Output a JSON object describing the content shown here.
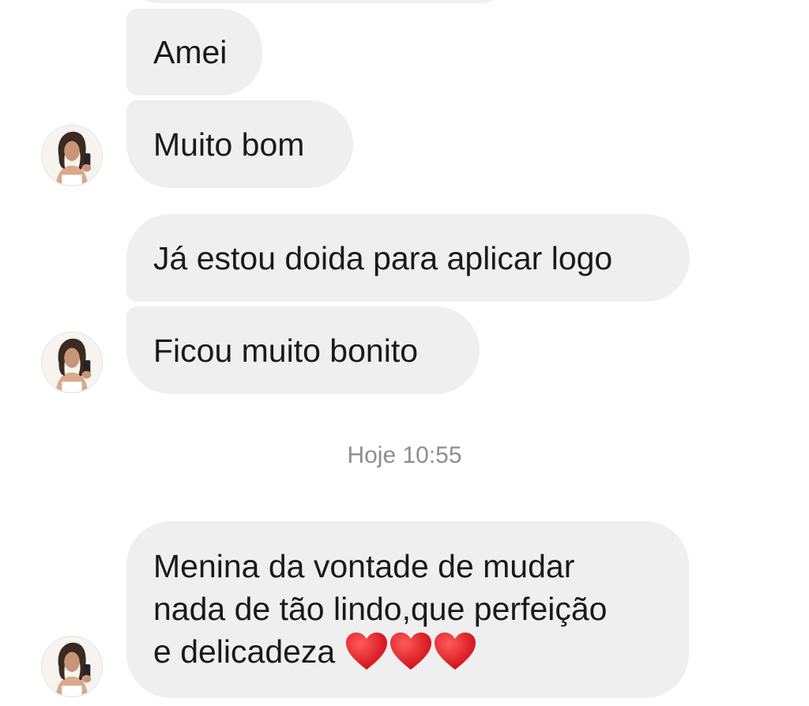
{
  "messages": [
    {
      "id": "top-cut",
      "text": ""
    },
    {
      "id": "m1",
      "text": "Amei"
    },
    {
      "id": "m2",
      "text": "Muito bom"
    },
    {
      "id": "m3",
      "text": "Já estou doida para aplicar logo"
    },
    {
      "id": "m4",
      "text": "Ficou muito bonito"
    },
    {
      "id": "m5",
      "lines": [
        "Menina da vontade de mudar",
        "nada de tão lindo,que perfeição",
        "e delicadeza "
      ],
      "emoji": "heart-icon x3"
    }
  ],
  "timestamp": "Hoje 10:55",
  "colors": {
    "bubble": "#efefef",
    "timestamp": "#8e8e8e",
    "heart": "#e0141e"
  }
}
